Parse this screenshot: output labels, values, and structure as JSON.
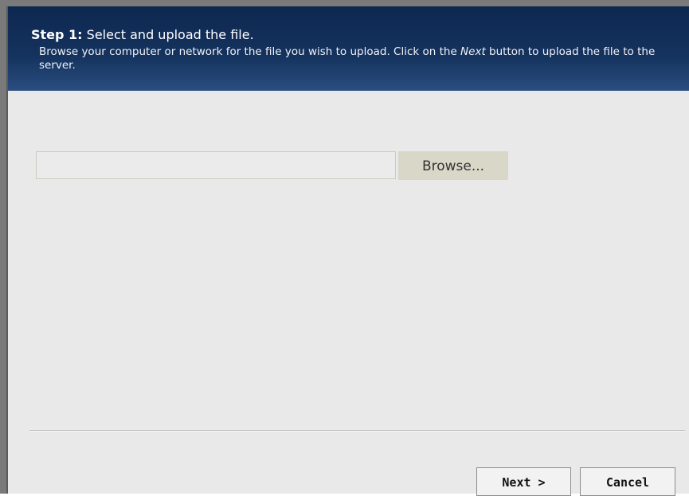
{
  "header": {
    "step_number": "Step 1:",
    "step_title": "Select and upload the file.",
    "description_before": "Browse your computer or network for the file you wish to upload. Click on the ",
    "description_emphasis": "Next",
    "description_after": " button to upload the file to the server."
  },
  "upload": {
    "file_value": "",
    "browse_label": "Browse..."
  },
  "footer": {
    "next_label": "Next >",
    "cancel_label": "Cancel"
  },
  "colors": {
    "header_bg": "#15335f",
    "body_bg": "#e9e9e9",
    "browse_bg": "#d8d7c8"
  }
}
